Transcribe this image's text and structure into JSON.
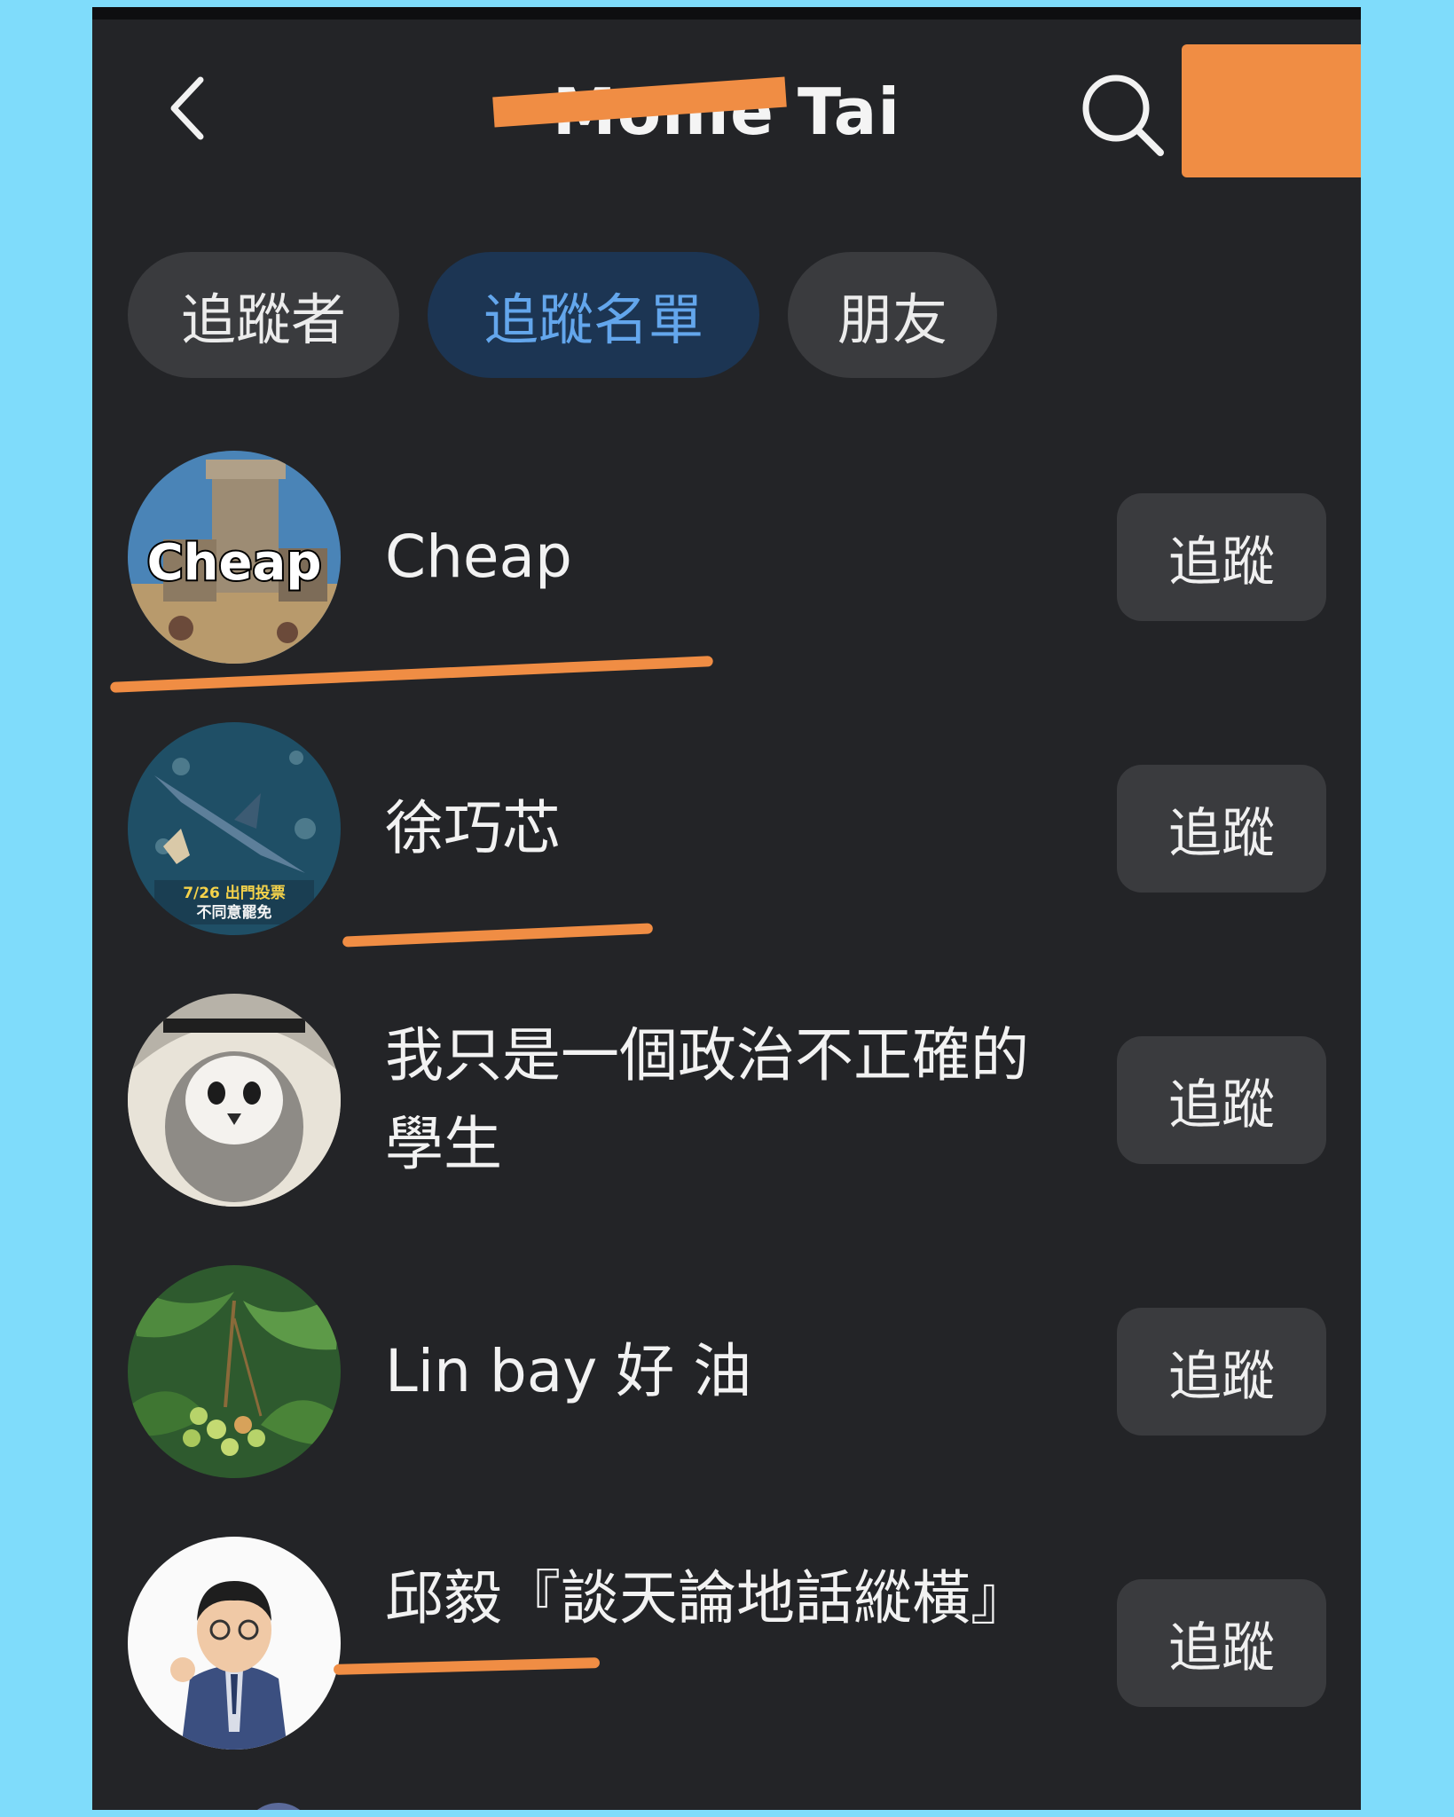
{
  "header": {
    "title": "Mollie Tai",
    "back_icon": "chevron-left-icon",
    "search_icon": "search-icon"
  },
  "tabs": [
    {
      "label": "追蹤者",
      "active": false
    },
    {
      "label": "追蹤名單",
      "active": true
    },
    {
      "label": "朋友",
      "active": false
    }
  ],
  "follow_label": "追蹤",
  "avatar_labels": {
    "cheap": "Cheap",
    "vote_line1": "7/26 出門投票",
    "vote_line2": "不同意罷免"
  },
  "users": [
    {
      "name": "Cheap"
    },
    {
      "name": "徐巧芯"
    },
    {
      "name": "我只是一個政治不正確的學生"
    },
    {
      "name": "Lin bay 好 油"
    },
    {
      "name": "邱毅『談天論地話縱橫』"
    }
  ],
  "colors": {
    "background": "#232427",
    "frame": "#7fdcfb",
    "redaction": "#f08d44",
    "active_tab_bg": "#1c3553",
    "active_tab_text": "#63a6ec",
    "button_bg": "#3a3b3e"
  }
}
